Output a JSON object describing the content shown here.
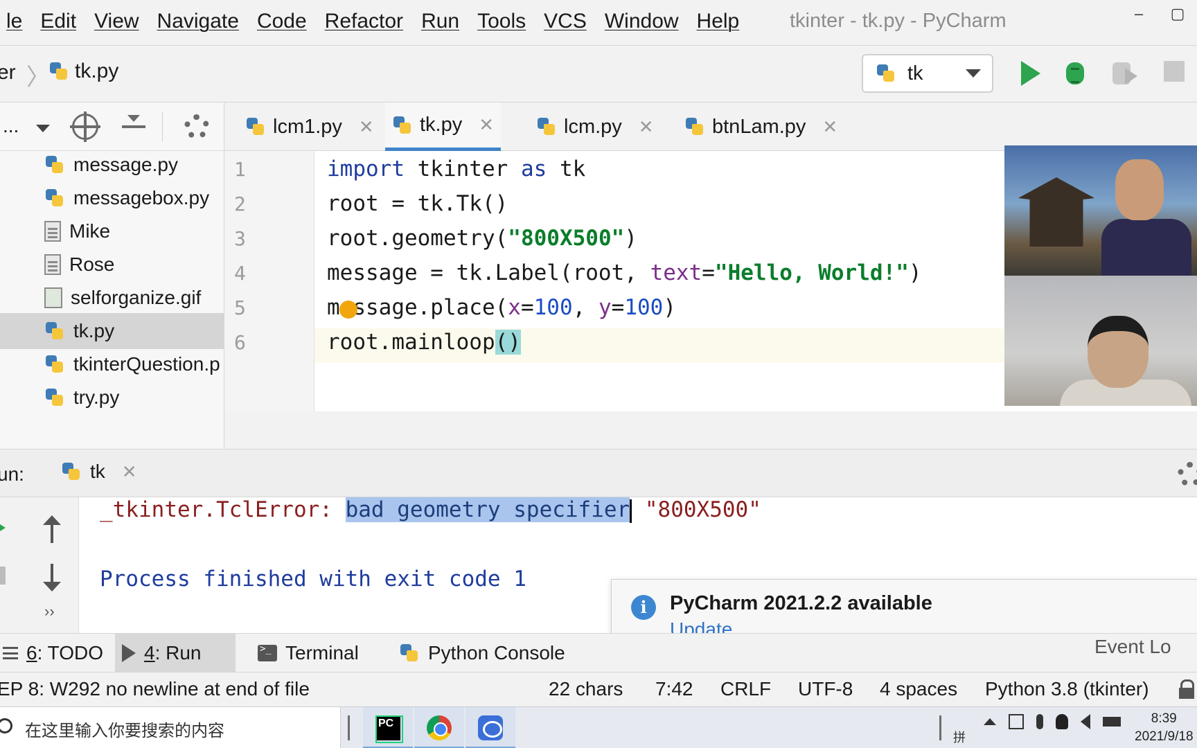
{
  "menubar": {
    "items": [
      "le",
      "Edit",
      "View",
      "Navigate",
      "Code",
      "Refactor",
      "Run",
      "Tools",
      "VCS",
      "Window",
      "Help"
    ],
    "window_title": "tkinter - tk.py - PyCharm",
    "minimize": "–",
    "restore": "▢"
  },
  "navbar": {
    "breadcrumb_project": "er",
    "breadcrumb_sep": "〉",
    "breadcrumb_file": "tk.py",
    "run_config": "tk"
  },
  "project": {
    "dropdown_label": "...",
    "files": [
      {
        "name": "message.py",
        "icon": "python-file-icon"
      },
      {
        "name": "messagebox.py",
        "icon": "python-file-icon"
      },
      {
        "name": "Mike",
        "icon": "text-file-icon"
      },
      {
        "name": "Rose",
        "icon": "text-file-icon"
      },
      {
        "name": "selforganize.gif",
        "icon": "image-file-icon"
      },
      {
        "name": "tk.py",
        "icon": "python-file-icon",
        "selected": true
      },
      {
        "name": "tkinterQuestion.p",
        "icon": "python-file-icon"
      },
      {
        "name": "try.py",
        "icon": "python-file-icon"
      }
    ]
  },
  "tabs": [
    {
      "label": "lcm1.py",
      "close": "✕"
    },
    {
      "label": "tk.py",
      "close": "✕",
      "active": true
    },
    {
      "label": "lcm.py",
      "close": "✕"
    },
    {
      "label": "btnLam.py",
      "close": "✕"
    }
  ],
  "editor": {
    "line_numbers": [
      "1",
      "2",
      "3",
      "4",
      "5",
      "6"
    ],
    "lines": [
      {
        "t1": "import",
        "t2": " tkinter ",
        "t3": "as",
        "t4": " tk"
      },
      {
        "t1": "root = tk.Tk()"
      },
      {
        "t1": "root.geometry(",
        "t2": "\"800X500\"",
        "t3": ")"
      },
      {
        "t1": "message = tk.Label(root, ",
        "t2": "text",
        "t3": "=",
        "t4": "\"Hello, World!\"",
        "t5": ")"
      },
      {
        "t1": "message.place(",
        "t2": "x",
        "t3": "=",
        "t4": "100",
        "t5": ", ",
        "t6": "y",
        "t7": "=",
        "t8": "100",
        "t9": ")"
      },
      {
        "t1": "root.mainloop",
        "t2": "()"
      }
    ]
  },
  "run": {
    "label": "un:",
    "tab": "tk",
    "tab_close": "✕",
    "error_prefix": "_tkinter.TclError: ",
    "error_selected": "bad geometry specifier",
    "error_suffix": " \"800X500\"",
    "process_line": "Process finished with exit code 1",
    "more": "››"
  },
  "notification": {
    "title": "PyCharm 2021.2.2 available",
    "link": "Update...",
    "icon_text": "i"
  },
  "tool_windows": [
    {
      "num": "6",
      "label": ": TODO"
    },
    {
      "num": "4",
      "label": ": Run",
      "active": true
    },
    {
      "num": "",
      "label": "Terminal"
    },
    {
      "num": "",
      "label": "Python Console"
    }
  ],
  "event_log": "Event Lo",
  "statusbar": {
    "inspection": "EP 8: W292 no newline at end of file",
    "chars": "22 chars",
    "position": "7:42",
    "line_sep": "CRLF",
    "encoding": "UTF-8",
    "indent": "4 spaces",
    "interpreter": "Python 3.8 (tkinter)"
  },
  "taskbar": {
    "search_placeholder": "在这里输入你要搜索的内容",
    "pycharm_icon_text": "PC",
    "ime": "拼",
    "time": "8:39",
    "date": "2021/9/18"
  },
  "colors": {
    "keyword": "#1f3c9e",
    "string": "#0b7d2b",
    "param": "#7a2e8a",
    "error": "#8a1f1f",
    "accent": "#4083c9"
  }
}
